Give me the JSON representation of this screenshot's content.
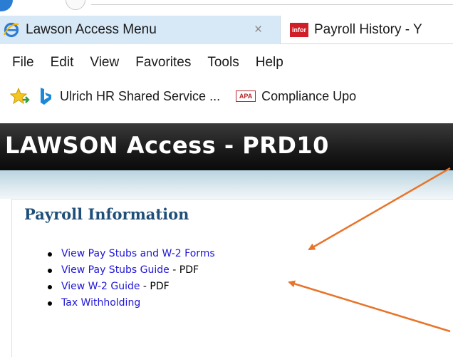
{
  "browser": {
    "tabs": [
      {
        "label": "Lawson Access Menu",
        "icon": "ie-icon",
        "active": true,
        "close": "×"
      },
      {
        "label": "Payroll History - Y",
        "icon": "infor-icon",
        "icon_text": "infor",
        "active": false
      }
    ],
    "menu": [
      "File",
      "Edit",
      "View",
      "Favorites",
      "Tools",
      "Help"
    ],
    "favorites": [
      {
        "label": "Ulrich HR Shared Service ...",
        "icon": "bing-icon"
      },
      {
        "label": "Compliance Upo",
        "icon": "apa-icon",
        "icon_text": "APA"
      }
    ]
  },
  "page": {
    "header_title": "LAWSON Access - PRD10",
    "section_title": "Payroll Information",
    "links": [
      {
        "label": "View Pay Stubs and W-2 Forms",
        "suffix": ""
      },
      {
        "label": "View Pay Stubs Guide",
        "suffix": " - PDF"
      },
      {
        "label": "View W-2 Guide",
        "suffix": " - PDF"
      },
      {
        "label": "Tax Withholding",
        "suffix": ""
      }
    ]
  },
  "colors": {
    "annotation_arrow": "#e8742a",
    "link": "#1f16d6",
    "section_title": "#1f4e79",
    "active_tab": "#d7e8f7",
    "header_bg": "#1c1c1c"
  }
}
